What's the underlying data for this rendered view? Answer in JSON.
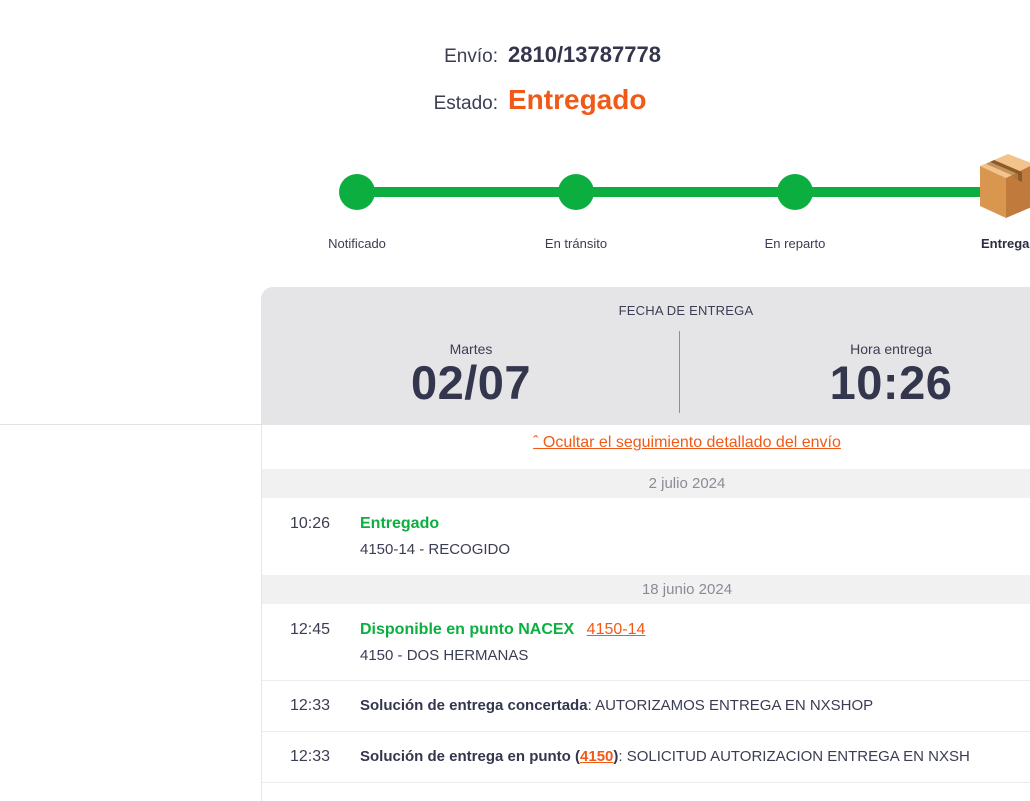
{
  "header": {
    "shipment_label": "Envío:",
    "shipment_number": "2810/13787778",
    "status_label": "Estado:",
    "status_value": "Entregado"
  },
  "progress": {
    "steps": [
      {
        "label": "Notificado"
      },
      {
        "label": "En tránsito"
      },
      {
        "label": "En reparto"
      },
      {
        "label": "Entrega"
      }
    ],
    "completed_color": "#0caf3f",
    "current_icon": "package-box-icon"
  },
  "delivery_card": {
    "title": "FECHA DE ENTREGA",
    "day_label": "Martes",
    "date": "02/07",
    "time_label": "Hora entrega",
    "time": "10:26"
  },
  "tracking": {
    "toggle_label": "ˆ Ocultar el seguimiento detallado del envío",
    "groups": [
      {
        "date": "2 julio 2024",
        "events": [
          {
            "time": "10:26",
            "title": "Entregado",
            "detail": "4150-14 - RECOGIDO"
          }
        ]
      },
      {
        "date": "18 junio 2024",
        "events": [
          {
            "time": "12:45",
            "title": "Disponible en punto NACEX",
            "link": "4150-14",
            "detail": "4150 - DOS HERMANAS"
          },
          {
            "time": "12:33",
            "title": "Solución de entrega concertada",
            "separator": ":",
            "text": " AUTORIZAMOS ENTREGA EN NXSHOP"
          },
          {
            "time": "12:33",
            "title_start": "Solución de entrega en punto (",
            "link": "4150",
            "title_end": ")",
            "text": ": SOLICITUD AUTORIZACION ENTREGA EN NXSH"
          }
        ]
      }
    ]
  },
  "colors": {
    "accent_orange": "#f05a17",
    "success_green": "#0caf3f",
    "text_dark": "#33364d"
  }
}
